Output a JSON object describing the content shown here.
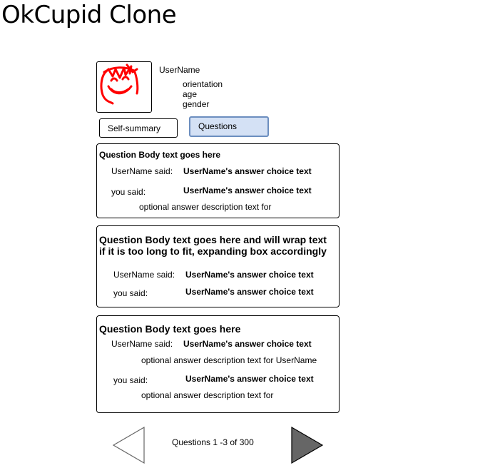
{
  "app": {
    "title": "OkCupid Clone"
  },
  "profile": {
    "username": "UserName",
    "orientation": "orientation",
    "age": "age",
    "gender": "gender"
  },
  "tabs": [
    {
      "label": "Self-summary",
      "active": false
    },
    {
      "label": "Questions",
      "active": true
    }
  ],
  "questions": [
    {
      "body": "Question Body text goes here",
      "their_label": "UserName said:",
      "their_answer": "UserName's answer choice text",
      "your_label": "you said:",
      "your_answer": "UserName's answer choice text",
      "your_description": "optional answer description text for"
    },
    {
      "body": "Question Body text goes here and will wrap text if it is too long to fit, expanding box accordingly",
      "their_label": "UserName said:",
      "their_answer": "UserName's answer choice text",
      "your_label": "you said:",
      "your_answer": "UserName's answer choice text"
    },
    {
      "body": "Question Body text goes here",
      "their_label": "UserName said:",
      "their_answer": "UserName's answer choice text",
      "their_description": "optional answer description text for UserName",
      "your_label": "you said:",
      "your_answer": "UserName's answer choice text",
      "your_description": "optional answer description text for"
    }
  ],
  "pagination": {
    "label": "Questions 1 -3 of 300",
    "prev_icon": "triangle-left-outline-icon",
    "next_icon": "triangle-right-filled-icon"
  },
  "colors": {
    "active_tab_fill": "#d4e1f5",
    "active_tab_border": "#6c8ebf",
    "avatar_sketch": "#ff0000",
    "next_button_fill": "#666666"
  }
}
